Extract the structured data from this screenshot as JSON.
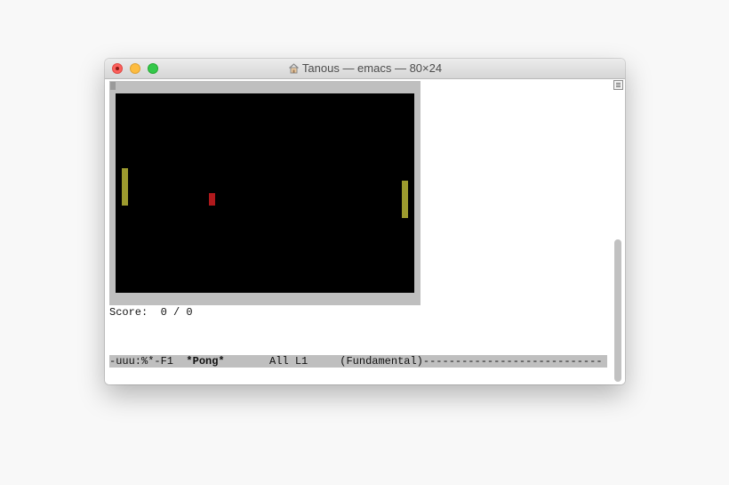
{
  "window": {
    "title": "Tanous — emacs — 80×24",
    "title_icon": "home-icon"
  },
  "game": {
    "score_text": "Score:  0 / 0",
    "colors": {
      "field": "#000000",
      "frame": "#bfbfbf",
      "paddle": "#9c9a2e",
      "ball": "#b0191c"
    }
  },
  "modeline": {
    "prefix": "-uuu:%*-F1  ",
    "buffer_name": "*Pong*",
    "position": "       All L1     ",
    "mode": "(Fundamental)",
    "fill": "----------------------------"
  }
}
